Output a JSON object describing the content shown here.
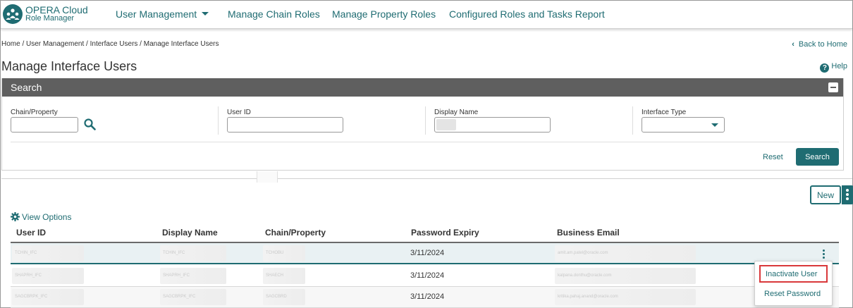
{
  "app": {
    "brand_line1": "OPERA Cloud",
    "brand_line2": "Role Manager",
    "logo_icon": "users-group-icon",
    "accent_color": "#1f6c72"
  },
  "nav": {
    "items": [
      {
        "label": "User Management",
        "has_dropdown": true
      },
      {
        "label": "Manage Chain Roles"
      },
      {
        "label": "Manage Property Roles"
      },
      {
        "label": "Configured Roles and Tasks Report"
      }
    ]
  },
  "breadcrumb": "Home / User Management / Interface Users / Manage Interface Users",
  "back_to_home": "Back to Home",
  "page_title": "Manage Interface Users",
  "help": "Help",
  "search": {
    "title": "Search",
    "fields": {
      "chain_property": {
        "label": "Chain/Property",
        "value": ""
      },
      "user_id": {
        "label": "User ID",
        "value": ""
      },
      "display_name": {
        "label": "Display Name",
        "value": ""
      },
      "interface_type": {
        "label": "Interface Type",
        "value": ""
      }
    },
    "reset_label": "Reset",
    "search_label": "Search"
  },
  "results": {
    "new_label": "New",
    "view_options_label": "View Options",
    "columns": [
      "User ID",
      "Display Name",
      "Chain/Property",
      "Password Expiry",
      "Business Email"
    ],
    "rows": [
      {
        "user_id": "TCHIN_IFC",
        "display_name": "TCHIN_IFC",
        "chain_property": "TCHOBU",
        "password_expiry": "3/11/2024",
        "business_email": "amit.am.patel@oracle.com"
      },
      {
        "user_id": "SHAPRH_IFC",
        "display_name": "SHAPRH_IFC",
        "chain_property": "SHAECH",
        "password_expiry": "3/11/2024",
        "business_email": "kalpana.donthu@oracle.com"
      },
      {
        "user_id": "SAGCBRPK_IFC",
        "display_name": "SAGCBRPK_IFC",
        "chain_property": "SAGCBRD",
        "password_expiry": "3/11/2024",
        "business_email": "kritika.pahaj.anand@oracle.com"
      }
    ],
    "row_menu": {
      "items": [
        "Inactivate User",
        "Reset Password"
      ],
      "highlighted_index": 0
    }
  }
}
